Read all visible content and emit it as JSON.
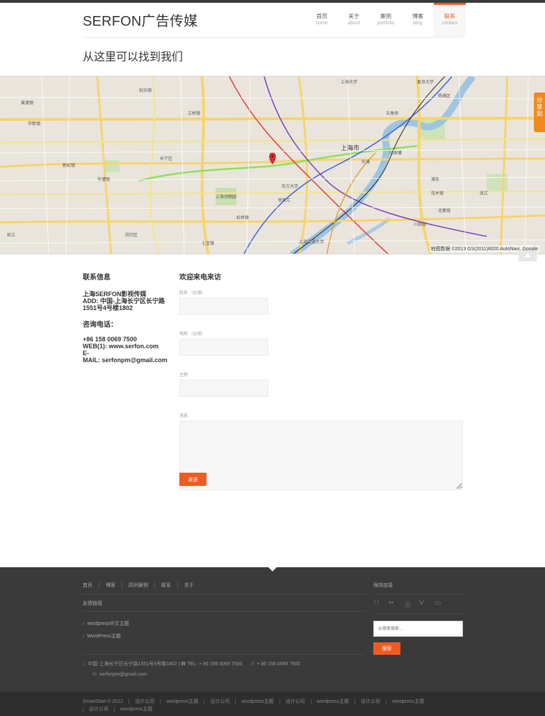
{
  "site": {
    "logo": "SERFON广告传媒"
  },
  "nav": {
    "items": [
      {
        "zh": "首页",
        "en": "home"
      },
      {
        "zh": "关于",
        "en": "about"
      },
      {
        "zh": "案例",
        "en": "portfolio"
      },
      {
        "zh": "博客",
        "en": "blog"
      },
      {
        "zh": "联系",
        "en": "contact"
      }
    ],
    "active_index": 4
  },
  "page": {
    "title": "从这里可以找到我们"
  },
  "map": {
    "credit": "地图数据 ©2013 GS(2011)6020 AutoNavi, Google",
    "city_label": "上海市",
    "labels": [
      "黄渡镇",
      "封浜镇",
      "江桥镇",
      "华新镇",
      "华漕镇",
      "新虹镇",
      "七宝镇",
      "虹桥镇",
      "上海动物园",
      "徐家汇",
      "上海大学",
      "外滩",
      "陆家嘴",
      "浦东",
      "张江",
      "北蔡镇",
      "川杨镇",
      "花木镇",
      "杨浦区",
      "五角场",
      "东方大学",
      "上海交通大学",
      "复旦大学",
      "长宁区",
      "闵行区",
      "松江"
    ],
    "share_label": "分享到"
  },
  "contact_info": {
    "heading": "联系信息",
    "company_lines": [
      "上海SERFON影视传媒",
      "ADD: 中国-上海长宁区长宁路",
      "1551号4号楼1802"
    ],
    "phone_heading": "咨询电话：",
    "lines": [
      "+86 158 0069 7500",
      "WEB(1): www.serfon.com",
      "E-",
      "MAIL: serfonpm@gmail.com"
    ]
  },
  "form": {
    "heading": "欢迎来电来访",
    "name_label": "姓名 （必填）",
    "email_label": "电邮 （必填）",
    "subject_label": "主题",
    "message_label": "消息",
    "submit_label": "发送"
  },
  "footer": {
    "nav": [
      "首页",
      "博客",
      "四列案例",
      "联系",
      "关于"
    ],
    "links_title": "友情链接",
    "links": [
      "wordpress中文主题",
      "WordPress主题"
    ],
    "address": "中国-上海长宁区长宁路1551号4号楼1802 | ☎ TEL: + 86 158 0069 7500",
    "phone": "+ 86 158 0069 7500",
    "email": "serfonpm@gmail.com",
    "keep_title": "保持连接",
    "search_placeholder": "从搜索搜索...",
    "search_button": "搜索"
  },
  "bottom": {
    "copyright": "SmartStart © 2012",
    "links": [
      "设计公司",
      "wordpress主题",
      "设计公司",
      "wordpress主题",
      "设计公司",
      "wordpress主题",
      "设计公司",
      "wordpress主题",
      "设计公司",
      "wordpress主题"
    ]
  },
  "colors": {
    "accent": "#f05a23",
    "share": "#f08a1c",
    "footer_bg": "#3a3a3a"
  }
}
